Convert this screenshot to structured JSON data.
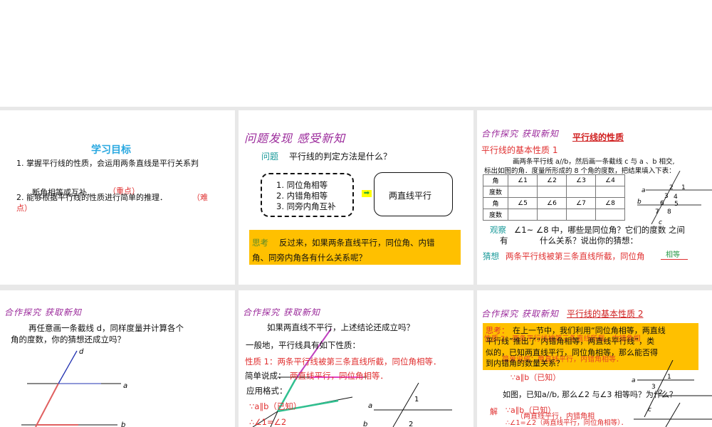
{
  "slides": [
    {
      "title": "学习目标",
      "line1": "1. 掌握平行线的性质，会运用两条直线是平行关系判",
      "line1b": "断角相等或互补．",
      "tag1": "（重点）",
      "line2": "2. 能够根据平行线的性质进行简单的推理．",
      "tag2a": "（难",
      "tag2b": "点）"
    },
    {
      "heading": "问题发现  感受新知",
      "q_label": "问题",
      "q_text": "平行线的判定方法是什么？",
      "conds": [
        "1. 同位角相等",
        "2. 内错角相等",
        "3. 同旁内角互补"
      ],
      "result": "两直线平行",
      "think_label": "思考",
      "think_text1": "反过来，如果两条直线平行，同位角、内错",
      "think_text2": "角、同旁内角各有什么关系呢？"
    },
    {
      "heading": "合作探究  获取新知",
      "title": "平行线的性质",
      "subtitle": "平行线的基本性质 1",
      "intro1": "画两条平行线 a//b，然后画一条截线 c 与 a 、b 相交,",
      "intro2": "标出如图的角．度量所形成的 8 个角的度数，把结果填入下表：",
      "table": [
        [
          "角",
          "∠1",
          "∠2",
          "∠3",
          "∠4"
        ],
        [
          "度数",
          "",
          "",
          "",
          ""
        ],
        [
          "角",
          "∠5",
          "∠6",
          "∠7",
          "∠8"
        ],
        [
          "度数",
          "",
          "",
          "",
          ""
        ]
      ],
      "observe_label": "观察",
      "observe1": "∠1~ ∠8 中，哪些是同位角？它们的度数  之间",
      "observe2a": "有",
      "observe2b": "什么关系？说出你的猜想：",
      "guess_label": "猜想",
      "guess_text": "两条平行线被第三条直线所截，同位角",
      "guess_answer": "相等",
      "fig": {
        "a": "a",
        "b": "b",
        "c": "c",
        "n": [
          "1",
          "2",
          "3",
          "4",
          "5",
          "6",
          "7",
          "8"
        ]
      }
    },
    {
      "heading": "合作探究  获取新知",
      "text1": "再任意画一条截线 d，同样度量并计算各个",
      "text2": "角的度数，你的猜想还成立吗？",
      "labels": {
        "d": "d",
        "a": "a",
        "b": "b"
      }
    },
    {
      "heading": "合作探究  获取新知",
      "q": "如果两直线不平行，上述结论还成立吗？",
      "general": "一般地，平行线具有如下性质：",
      "prop1": "性质 1：两条平行线被第三条直线所截，同位角相等．",
      "short_label": "简单说成：",
      "short": "两直线平行，同位角相等．",
      "format": "应用格式：",
      "f1": "∵a∥b（已知）",
      "f2": "∴∠1=∠2",
      "labels": {
        "a": "a",
        "b": "b",
        "n1": "1",
        "n2": "2"
      }
    },
    {
      "heading": "合作探究  获取新知",
      "title": "平行线的基本性质 2",
      "think_label": "思考：",
      "think1": "在上一节中，我们利用“同位角相等，两直线",
      "think2": "平行线”推出了“内错角相等，两直线平行线”，类",
      "think3": "似的，已知两直线平行，同位角相等，那么能否得",
      "think4": "到内错角的数量关系？",
      "ghost1": "性质 2：两条平行线被第三条直线所截，内错角相",
      "ghost2": "简单说成：两直线平行，内错角相等．",
      "f1": "∵a∥b（已知）",
      "question": "如图，已知a//b, 那么∠2 与∠3 相等吗？为什么？",
      "sol": "解",
      "sol1": "∵a∥b（已知）",
      "sol1b": "（两直线平行，内错角相",
      "sol2": "∴∠1=∠2（两直线平行，同位角相等）．",
      "labels": {
        "a": "a",
        "c": "c",
        "n1": "1",
        "n2": "2",
        "n3": "3"
      }
    }
  ]
}
